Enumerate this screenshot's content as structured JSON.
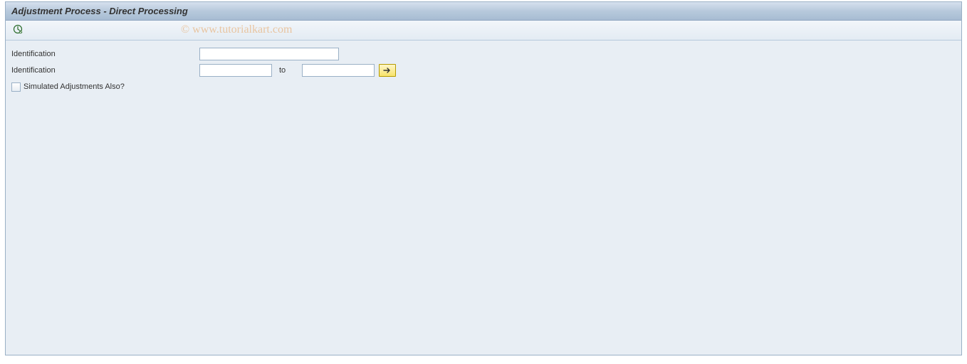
{
  "window": {
    "title": "Adjustment Process - Direct Processing"
  },
  "toolbar": {
    "execute_tooltip": "Execute"
  },
  "watermark": "© www.tutorialkart.com",
  "form": {
    "row1": {
      "label": "Identification",
      "value": ""
    },
    "row2": {
      "label": "Identification",
      "from_value": "",
      "to_label": "to",
      "to_value": ""
    },
    "checkbox": {
      "label": "Simulated Adjustments Also?",
      "checked": false
    }
  }
}
